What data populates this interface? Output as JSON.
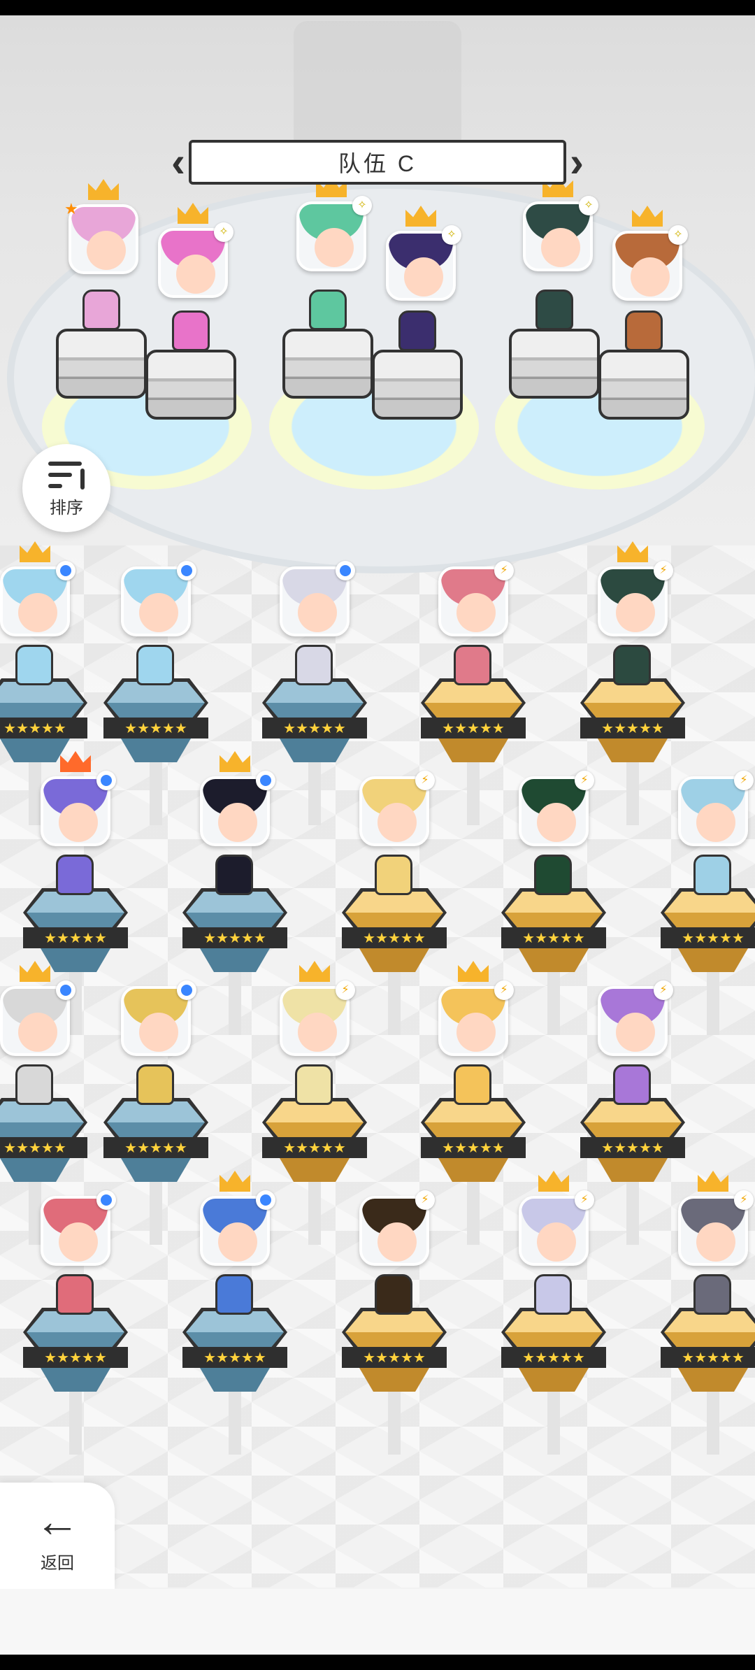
{
  "team": {
    "name": "队伍 C",
    "prev_icon": "chevron-left-icon",
    "next_icon": "chevron-right-icon"
  },
  "sort_button": {
    "label": "排序",
    "icon": "sort-descending-icon"
  },
  "back_button": {
    "label": "返回",
    "icon": "arrow-left-icon"
  },
  "colors": {
    "attr_blue": "#3a86ff",
    "attr_bolt": "#f0a500",
    "crown_gold": "#f7b32b",
    "crown_orange": "#ff6a2b",
    "pedestal_blue": "#5c8ea8",
    "pedestal_gold": "#d8a23a",
    "star": "#ffd23c"
  },
  "team_slots": [
    {
      "hair": "#e8a6d8",
      "badge": "star",
      "crown": true
    },
    {
      "hair": "#e873c9",
      "badge": "spark",
      "crown": true
    },
    {
      "hair": "#5ec79f",
      "badge": "spark",
      "crown": true
    },
    {
      "hair": "#3b2e6e",
      "badge": "spark",
      "crown": true
    },
    {
      "hair": "#2e4b45",
      "badge": "spark",
      "crown": true
    },
    {
      "hair": "#b86a3a",
      "badge": "spark",
      "crown": true
    }
  ],
  "roster": [
    {
      "hair": "#9fd6ee",
      "badge": "dot",
      "crown": "gold",
      "pedestal": "blue",
      "stars": 5
    },
    {
      "hair": "#9fd6ee",
      "badge": "dot",
      "crown": "",
      "pedestal": "blue",
      "stars": 5
    },
    {
      "hair": "#d8d8e6",
      "badge": "dot",
      "crown": "",
      "pedestal": "blue",
      "stars": 5
    },
    {
      "hair": "#e07a8a",
      "badge": "bolt",
      "crown": "",
      "pedestal": "gold",
      "stars": 5
    },
    {
      "hair": "#2c4a40",
      "badge": "bolt",
      "crown": "gold",
      "pedestal": "gold",
      "stars": 5
    },
    {
      "hair": "#7a6ad8",
      "badge": "dot",
      "crown": "orange",
      "pedestal": "blue",
      "stars": 5
    },
    {
      "hair": "#1c1c2c",
      "badge": "dot",
      "crown": "gold",
      "pedestal": "blue",
      "stars": 5
    },
    {
      "hair": "#f1d27a",
      "badge": "bolt",
      "crown": "",
      "pedestal": "gold",
      "stars": 5
    },
    {
      "hair": "#1f4a32",
      "badge": "bolt",
      "crown": "",
      "pedestal": "gold",
      "stars": 5
    },
    {
      "hair": "#9ed0e6",
      "badge": "bolt",
      "crown": "",
      "pedestal": "gold",
      "stars": 5
    },
    {
      "hair": "#d8d8d8",
      "badge": "dot",
      "crown": "gold",
      "pedestal": "blue",
      "stars": 5
    },
    {
      "hair": "#e6c35a",
      "badge": "dot",
      "crown": "",
      "pedestal": "blue",
      "stars": 5
    },
    {
      "hair": "#efe2a6",
      "badge": "bolt",
      "crown": "gold",
      "pedestal": "gold",
      "stars": 5
    },
    {
      "hair": "#f4c35a",
      "badge": "bolt",
      "crown": "gold",
      "pedestal": "gold",
      "stars": 5
    },
    {
      "hair": "#a877d8",
      "badge": "bolt",
      "crown": "",
      "pedestal": "gold",
      "stars": 5
    },
    {
      "hair": "#e06c7a",
      "badge": "dot",
      "crown": "",
      "pedestal": "blue",
      "stars": 5
    },
    {
      "hair": "#4a7ad8",
      "badge": "dot",
      "crown": "gold",
      "pedestal": "blue",
      "stars": 5
    },
    {
      "hair": "#3a2a1a",
      "badge": "bolt",
      "crown": "",
      "pedestal": "gold",
      "stars": 5
    },
    {
      "hair": "#c8c8e8",
      "badge": "bolt",
      "crown": "gold",
      "pedestal": "gold",
      "stars": 5
    },
    {
      "hair": "#6a6a7a",
      "badge": "bolt",
      "crown": "gold",
      "pedestal": "gold",
      "stars": 5
    }
  ]
}
